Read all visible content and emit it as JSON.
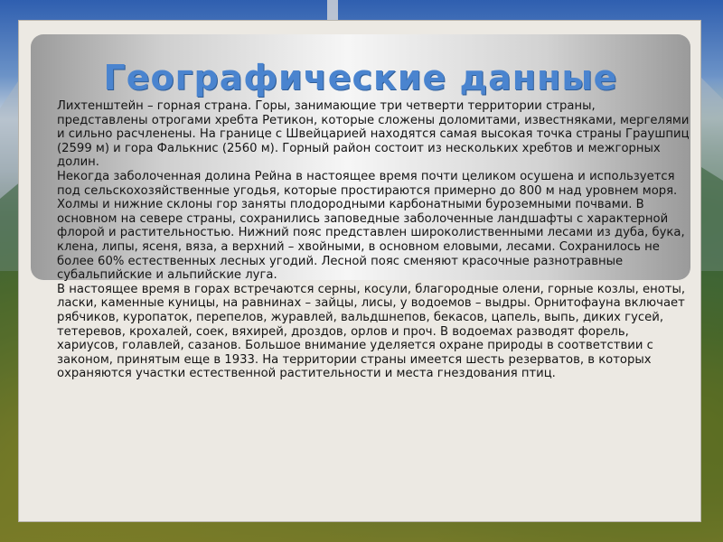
{
  "slide": {
    "title": "Географические данные",
    "body": "Лихтенштейн – горная страна. Горы, занимающие три четверти территории страны, представлены отрогами хребта Ретикон, которые сложены доломитами, известняками, мергелями и сильно расчленены. На границе с Швейцарией находятся самая высокая точка страны Граушпиц (2599 м) и гора Фалькнис (2560 м). Горный район состоит из нескольких хребтов и межгорных долин.\n Некогда заболоченная долина Рейна в настоящее время почти целиком осушена и используется под сельскохозяйственные угодья, которые простираются примерно до 800 м над уровнем моря. Холмы и нижние склоны гор заняты плодородными карбонатными буроземными почвами. В основном на севере страны, сохранились заповедные заболоченные ландшафты с характерной флорой и растительностью. Нижний пояс представлен широколиственными лесами из дуба, бука, клена, липы, ясеня, вяза, а верхний – хвойными, в основном еловыми, лесами. Сохранилось не более 60% естественных лесных угодий. Лесной пояс сменяют красочные разнотравные субальпийские и альпийские луга.\nВ настоящее время в горах встречаются серны, косули, благородные олени, горные козлы, еноты, ласки, каменные куницы, на равнинах – зайцы, лисы, у водоемов – выдры. Орнитофауна включает рябчиков, куропаток, перепелов, журавлей, вальдшнепов, бекасов, цапель, выпь, диких гусей, тетеревов, крохалей, соек, вяхирей, дроздов, орлов и проч. В водоемах разводят форель, хариусов, голавлей, сазанов. Большое внимание уделяется охране природы в соответствии с законом, принятым еще в 1933. На территории страны имеется шесть резерватов, в которых охраняются участки естественной растительности и места гнездования птиц."
  },
  "colors": {
    "title": "#4a84cf",
    "text": "#141414",
    "frame": "#ece9e3"
  }
}
